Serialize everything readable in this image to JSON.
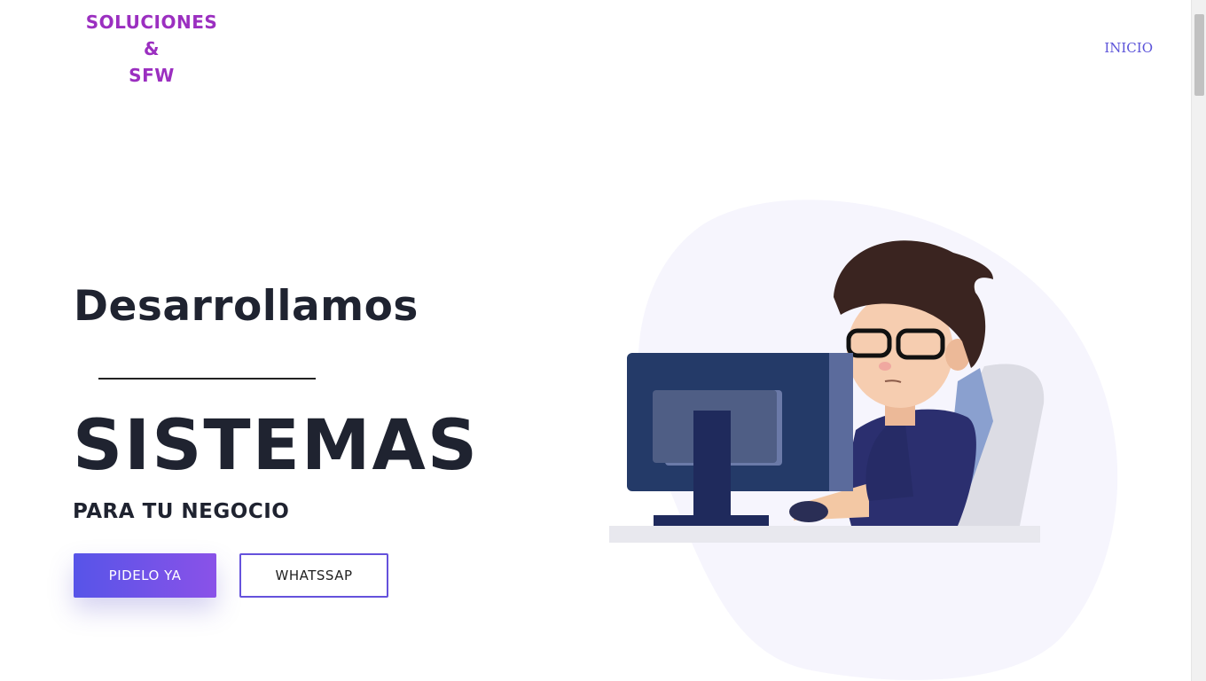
{
  "brand": {
    "line1": "SOLUCIONES",
    "line2": "&",
    "line3": "SFW"
  },
  "nav": {
    "inicio": "INICIO"
  },
  "hero": {
    "title": "Desarrollamos",
    "headline": "SISTEMAS",
    "subtitle": "PARA TU NEGOCIO"
  },
  "buttons": {
    "primary": "PIDELO YA",
    "secondary": "WHATSSAP"
  },
  "colors": {
    "brand_purple": "#9b2fc0",
    "nav_link": "#5b53d9",
    "button_gradient_start": "#5754e8",
    "button_gradient_end": "#8a52e8"
  }
}
